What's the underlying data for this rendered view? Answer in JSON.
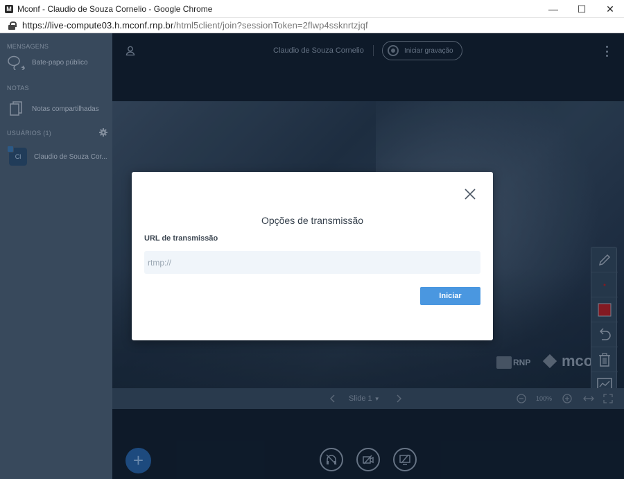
{
  "window": {
    "title": "Mconf - Claudio de Souza Cornelio - Google Chrome",
    "app_icon": "M",
    "minimize_label": "—",
    "maximize_label": "☐",
    "close_label": "✕"
  },
  "addressbar": {
    "url_host": "https://live-compute03.h.mconf.rnp.br",
    "url_path": "/html5client/join?sessionToken=2flwp4ssknrtzjqf"
  },
  "sidebar": {
    "messages_header": "MENSAGENS",
    "public_chat": "Bate-papo público",
    "notes_header": "NOTAS",
    "shared_notes": "Notas compartilhadas",
    "users_header": "USUÁRIOS (1)",
    "user": {
      "initials": "Cl",
      "name": "Claudio de Souza Cor..."
    }
  },
  "topbar": {
    "user_name": "Claudio de Souza Cornelio",
    "record_label": "Iniciar gravação"
  },
  "presentation": {
    "brand_rnp": "RNP",
    "brand_mconf": "mconf",
    "slide_label": "Slide 1",
    "zoom": "100%"
  },
  "colors": {
    "accent": "#4a97e0",
    "sidebar_bg": "#3b4d61",
    "main_bg": "#0f1c2c",
    "whiteboard_color": "#8b1c24"
  },
  "modal": {
    "title": "Opções de transmissão",
    "field_label": "URL de transmissão",
    "input_value": "",
    "input_placeholder": "rtmp://",
    "start_button": "Iniciar"
  }
}
